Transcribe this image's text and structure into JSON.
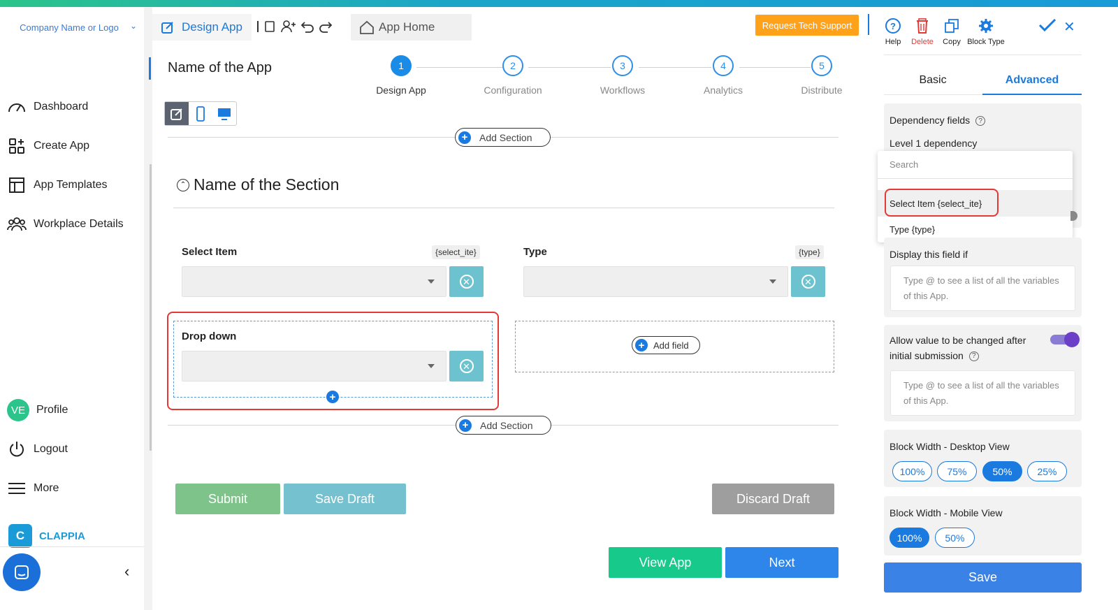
{
  "sidebar": {
    "company": "Company Name or Logo",
    "items": [
      {
        "label": "Dashboard",
        "icon": "gauge-icon"
      },
      {
        "label": "Create App",
        "icon": "grid-plus-icon"
      },
      {
        "label": "App Templates",
        "icon": "templates-icon"
      },
      {
        "label": "Workplace Details",
        "icon": "users-icon"
      }
    ],
    "profile": {
      "initials": "VE",
      "label": "Profile"
    },
    "logout": "Logout",
    "more": "More",
    "brand": "CLAPPIA"
  },
  "header": {
    "design_tab": "Design App",
    "app_home": "App Home",
    "tech_support": "Request Tech Support"
  },
  "app": {
    "name": "Name of the App",
    "steps": [
      {
        "num": "1",
        "label": "Design App"
      },
      {
        "num": "2",
        "label": "Configuration"
      },
      {
        "num": "3",
        "label": "Workflows"
      },
      {
        "num": "4",
        "label": "Analytics"
      },
      {
        "num": "5",
        "label": "Distribute"
      }
    ]
  },
  "canvas": {
    "add_section": "Add Section",
    "section_title": "Name of the Section",
    "fields": [
      {
        "label": "Select Item",
        "var": "{select_ite}"
      },
      {
        "label": "Type",
        "var": "{type}"
      },
      {
        "label": "Drop down"
      }
    ],
    "add_field": "Add field",
    "submit": "Submit",
    "save_draft": "Save Draft",
    "discard_draft": "Discard Draft",
    "view_app": "View App",
    "next": "Next"
  },
  "panel": {
    "tools": {
      "help": "Help",
      "delete": "Delete",
      "copy": "Copy",
      "block_type": "Block Type"
    },
    "tabs": {
      "basic": "Basic",
      "advanced": "Advanced"
    },
    "dependency_fields": "Dependency fields",
    "level1": "Level 1 dependency",
    "dropdown": {
      "search_placeholder": "Search",
      "items": [
        "Select Item {select_ite}",
        "Type {type}"
      ]
    },
    "display_if": "Display this field if",
    "ta_placeholder": "Type @ to see a list of all the variables of this App.",
    "allow_change": "Allow value to be changed after initial submission",
    "allow_change_enabled": true,
    "block_width_desktop": "Block Width - Desktop View",
    "desktop_options": [
      "100%",
      "75%",
      "50%",
      "25%"
    ],
    "desktop_selected": "50%",
    "block_width_mobile": "Block Width - Mobile View",
    "mobile_options": [
      "100%",
      "50%"
    ],
    "mobile_selected": "100%",
    "save": "Save"
  },
  "colors": {
    "accent": "#1a7ae0",
    "submit": "#7ec48a",
    "save_draft": "#75c1cf",
    "discard": "#9e9e9e",
    "view_app": "#17c98a",
    "next": "#2e86ea",
    "tech_support": "#ffa21a"
  }
}
